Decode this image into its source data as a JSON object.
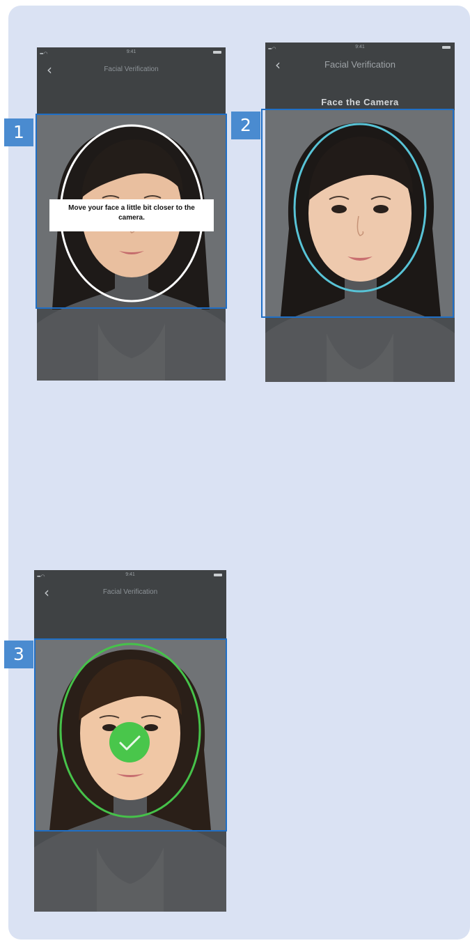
{
  "screens": [
    {
      "step": "1",
      "status_time": "9:41",
      "title": "Facial Verification",
      "back_icon": "chevron-left-icon",
      "hint": "Move your face a little bit closer to the camera.",
      "oval_color": "#ffffff"
    },
    {
      "step": "2",
      "status_time": "9:41",
      "title": "Facial Verification",
      "back_icon": "chevron-left-icon",
      "instruction": "Face the Camera",
      "oval_color": "#58c3d6"
    },
    {
      "step": "3",
      "status_time": "9:41",
      "title": "Facial Verification",
      "back_icon": "chevron-left-icon",
      "oval_color": "#46c24a",
      "success_icon": "checkmark-icon"
    }
  ],
  "colors": {
    "card_background": "#dae2f3",
    "highlight_border": "#1f6fc6",
    "badge": "#4a8bd0",
    "success": "#49c64b"
  }
}
